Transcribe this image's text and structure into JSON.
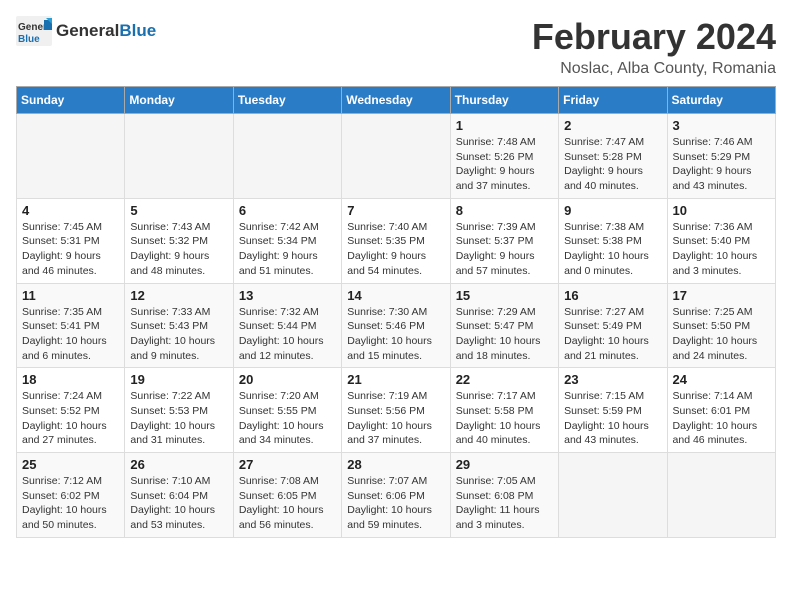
{
  "header": {
    "logo_general": "General",
    "logo_blue": "Blue",
    "title": "February 2024",
    "subtitle": "Noslac, Alba County, Romania"
  },
  "weekdays": [
    "Sunday",
    "Monday",
    "Tuesday",
    "Wednesday",
    "Thursday",
    "Friday",
    "Saturday"
  ],
  "weeks": [
    [
      {
        "day": "",
        "info": ""
      },
      {
        "day": "",
        "info": ""
      },
      {
        "day": "",
        "info": ""
      },
      {
        "day": "",
        "info": ""
      },
      {
        "day": "1",
        "info": "Sunrise: 7:48 AM\nSunset: 5:26 PM\nDaylight: 9 hours and 37 minutes."
      },
      {
        "day": "2",
        "info": "Sunrise: 7:47 AM\nSunset: 5:28 PM\nDaylight: 9 hours and 40 minutes."
      },
      {
        "day": "3",
        "info": "Sunrise: 7:46 AM\nSunset: 5:29 PM\nDaylight: 9 hours and 43 minutes."
      }
    ],
    [
      {
        "day": "4",
        "info": "Sunrise: 7:45 AM\nSunset: 5:31 PM\nDaylight: 9 hours and 46 minutes."
      },
      {
        "day": "5",
        "info": "Sunrise: 7:43 AM\nSunset: 5:32 PM\nDaylight: 9 hours and 48 minutes."
      },
      {
        "day": "6",
        "info": "Sunrise: 7:42 AM\nSunset: 5:34 PM\nDaylight: 9 hours and 51 minutes."
      },
      {
        "day": "7",
        "info": "Sunrise: 7:40 AM\nSunset: 5:35 PM\nDaylight: 9 hours and 54 minutes."
      },
      {
        "day": "8",
        "info": "Sunrise: 7:39 AM\nSunset: 5:37 PM\nDaylight: 9 hours and 57 minutes."
      },
      {
        "day": "9",
        "info": "Sunrise: 7:38 AM\nSunset: 5:38 PM\nDaylight: 10 hours and 0 minutes."
      },
      {
        "day": "10",
        "info": "Sunrise: 7:36 AM\nSunset: 5:40 PM\nDaylight: 10 hours and 3 minutes."
      }
    ],
    [
      {
        "day": "11",
        "info": "Sunrise: 7:35 AM\nSunset: 5:41 PM\nDaylight: 10 hours and 6 minutes."
      },
      {
        "day": "12",
        "info": "Sunrise: 7:33 AM\nSunset: 5:43 PM\nDaylight: 10 hours and 9 minutes."
      },
      {
        "day": "13",
        "info": "Sunrise: 7:32 AM\nSunset: 5:44 PM\nDaylight: 10 hours and 12 minutes."
      },
      {
        "day": "14",
        "info": "Sunrise: 7:30 AM\nSunset: 5:46 PM\nDaylight: 10 hours and 15 minutes."
      },
      {
        "day": "15",
        "info": "Sunrise: 7:29 AM\nSunset: 5:47 PM\nDaylight: 10 hours and 18 minutes."
      },
      {
        "day": "16",
        "info": "Sunrise: 7:27 AM\nSunset: 5:49 PM\nDaylight: 10 hours and 21 minutes."
      },
      {
        "day": "17",
        "info": "Sunrise: 7:25 AM\nSunset: 5:50 PM\nDaylight: 10 hours and 24 minutes."
      }
    ],
    [
      {
        "day": "18",
        "info": "Sunrise: 7:24 AM\nSunset: 5:52 PM\nDaylight: 10 hours and 27 minutes."
      },
      {
        "day": "19",
        "info": "Sunrise: 7:22 AM\nSunset: 5:53 PM\nDaylight: 10 hours and 31 minutes."
      },
      {
        "day": "20",
        "info": "Sunrise: 7:20 AM\nSunset: 5:55 PM\nDaylight: 10 hours and 34 minutes."
      },
      {
        "day": "21",
        "info": "Sunrise: 7:19 AM\nSunset: 5:56 PM\nDaylight: 10 hours and 37 minutes."
      },
      {
        "day": "22",
        "info": "Sunrise: 7:17 AM\nSunset: 5:58 PM\nDaylight: 10 hours and 40 minutes."
      },
      {
        "day": "23",
        "info": "Sunrise: 7:15 AM\nSunset: 5:59 PM\nDaylight: 10 hours and 43 minutes."
      },
      {
        "day": "24",
        "info": "Sunrise: 7:14 AM\nSunset: 6:01 PM\nDaylight: 10 hours and 46 minutes."
      }
    ],
    [
      {
        "day": "25",
        "info": "Sunrise: 7:12 AM\nSunset: 6:02 PM\nDaylight: 10 hours and 50 minutes."
      },
      {
        "day": "26",
        "info": "Sunrise: 7:10 AM\nSunset: 6:04 PM\nDaylight: 10 hours and 53 minutes."
      },
      {
        "day": "27",
        "info": "Sunrise: 7:08 AM\nSunset: 6:05 PM\nDaylight: 10 hours and 56 minutes."
      },
      {
        "day": "28",
        "info": "Sunrise: 7:07 AM\nSunset: 6:06 PM\nDaylight: 10 hours and 59 minutes."
      },
      {
        "day": "29",
        "info": "Sunrise: 7:05 AM\nSunset: 6:08 PM\nDaylight: 11 hours and 3 minutes."
      },
      {
        "day": "",
        "info": ""
      },
      {
        "day": "",
        "info": ""
      }
    ]
  ]
}
